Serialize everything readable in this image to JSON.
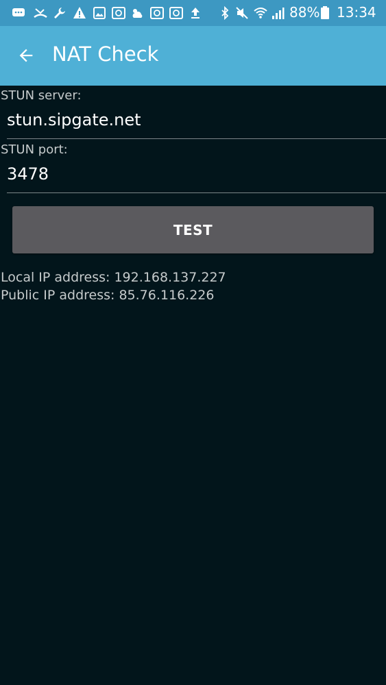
{
  "status_bar": {
    "icons": [
      "chat-bubble-icon",
      "missed-call-icon",
      "wrench-icon",
      "warning-icon",
      "image-icon",
      "mail-at-icon",
      "weather-icon",
      "mail-at-icon",
      "mail-at-icon",
      "upload-icon"
    ],
    "right_icons": [
      "bluetooth-icon",
      "mute-icon",
      "wifi-icon",
      "signal-icon"
    ],
    "battery_percent": "88%",
    "time": "13:34"
  },
  "app_bar": {
    "title": "NAT Check"
  },
  "form": {
    "server_label": "STUN server:",
    "server_value": "stun.sipgate.net",
    "port_label": "STUN port:",
    "port_value": "3478",
    "test_button_label": "TEST"
  },
  "results": {
    "local_ip": "Local IP address: 192.168.137.227",
    "public_ip": "Public IP address: 85.76.116.226"
  },
  "colors": {
    "status_bar": "#3d98c2",
    "app_bar": "#4fb0d6",
    "background": "#02151b",
    "button": "#5b5a5e"
  }
}
